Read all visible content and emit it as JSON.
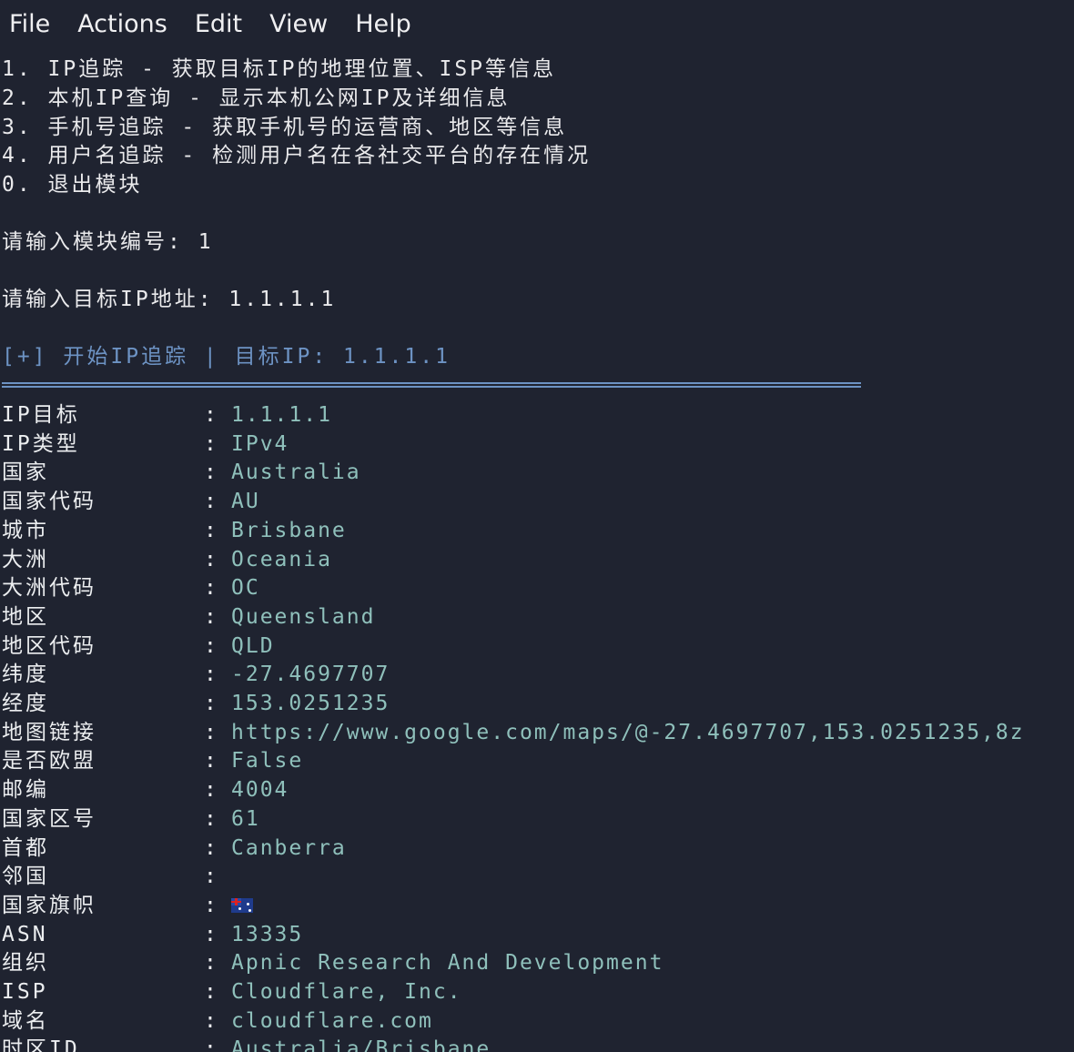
{
  "menu": [
    "File",
    "Actions",
    "Edit",
    "View",
    "Help"
  ],
  "menu_lines": [
    "1. IP追踪 - 获取目标IP的地理位置、ISP等信息",
    "2. 本机IP查询 - 显示本机公网IP及详细信息",
    "3. 手机号追踪 - 获取手机号的运营商、地区等信息",
    "4. 用户名追踪 - 检测用户名在各社交平台的存在情况",
    "0. 退出模块"
  ],
  "prompt_module": "请输入模块编号: 1",
  "prompt_ip": "请输入目标IP地址: 1.1.1.1",
  "start_line": "[+] 开始IP追踪 | 目标IP: 1.1.1.1",
  "separator": ":",
  "fields": [
    {
      "key": "IP目标",
      "value": "1.1.1.1"
    },
    {
      "key": "IP类型",
      "value": "IPv4"
    },
    {
      "key": "国家",
      "value": "Australia"
    },
    {
      "key": "国家代码",
      "value": "AU"
    },
    {
      "key": "城市",
      "value": "Brisbane"
    },
    {
      "key": "大洲",
      "value": "Oceania"
    },
    {
      "key": "大洲代码",
      "value": "OC"
    },
    {
      "key": "地区",
      "value": "Queensland"
    },
    {
      "key": "地区代码",
      "value": "QLD"
    },
    {
      "key": "纬度",
      "value": "-27.4697707"
    },
    {
      "key": "经度",
      "value": "153.0251235"
    },
    {
      "key": "地图链接",
      "value": "https://www.google.com/maps/@-27.4697707,153.0251235,8z"
    },
    {
      "key": "是否欧盟",
      "value": "False"
    },
    {
      "key": "邮编",
      "value": "4004"
    },
    {
      "key": "国家区号",
      "value": "61"
    },
    {
      "key": "首都",
      "value": "Canberra"
    },
    {
      "key": "邻国",
      "value": ""
    },
    {
      "key": "国家旗帜",
      "value": "",
      "icon": "australia-flag-icon"
    },
    {
      "key": "ASN",
      "value": "13335"
    },
    {
      "key": "组织",
      "value": "Apnic Research And Development"
    },
    {
      "key": "ISP",
      "value": "Cloudflare, Inc."
    },
    {
      "key": "域名",
      "value": "cloudflare.com"
    },
    {
      "key": "时区ID",
      "value": "Australia/Brisbane"
    }
  ],
  "colors": {
    "background": "#1f2330",
    "text": "#eaeaec",
    "value": "#8fc0bb",
    "accent": "#6d93c4"
  }
}
